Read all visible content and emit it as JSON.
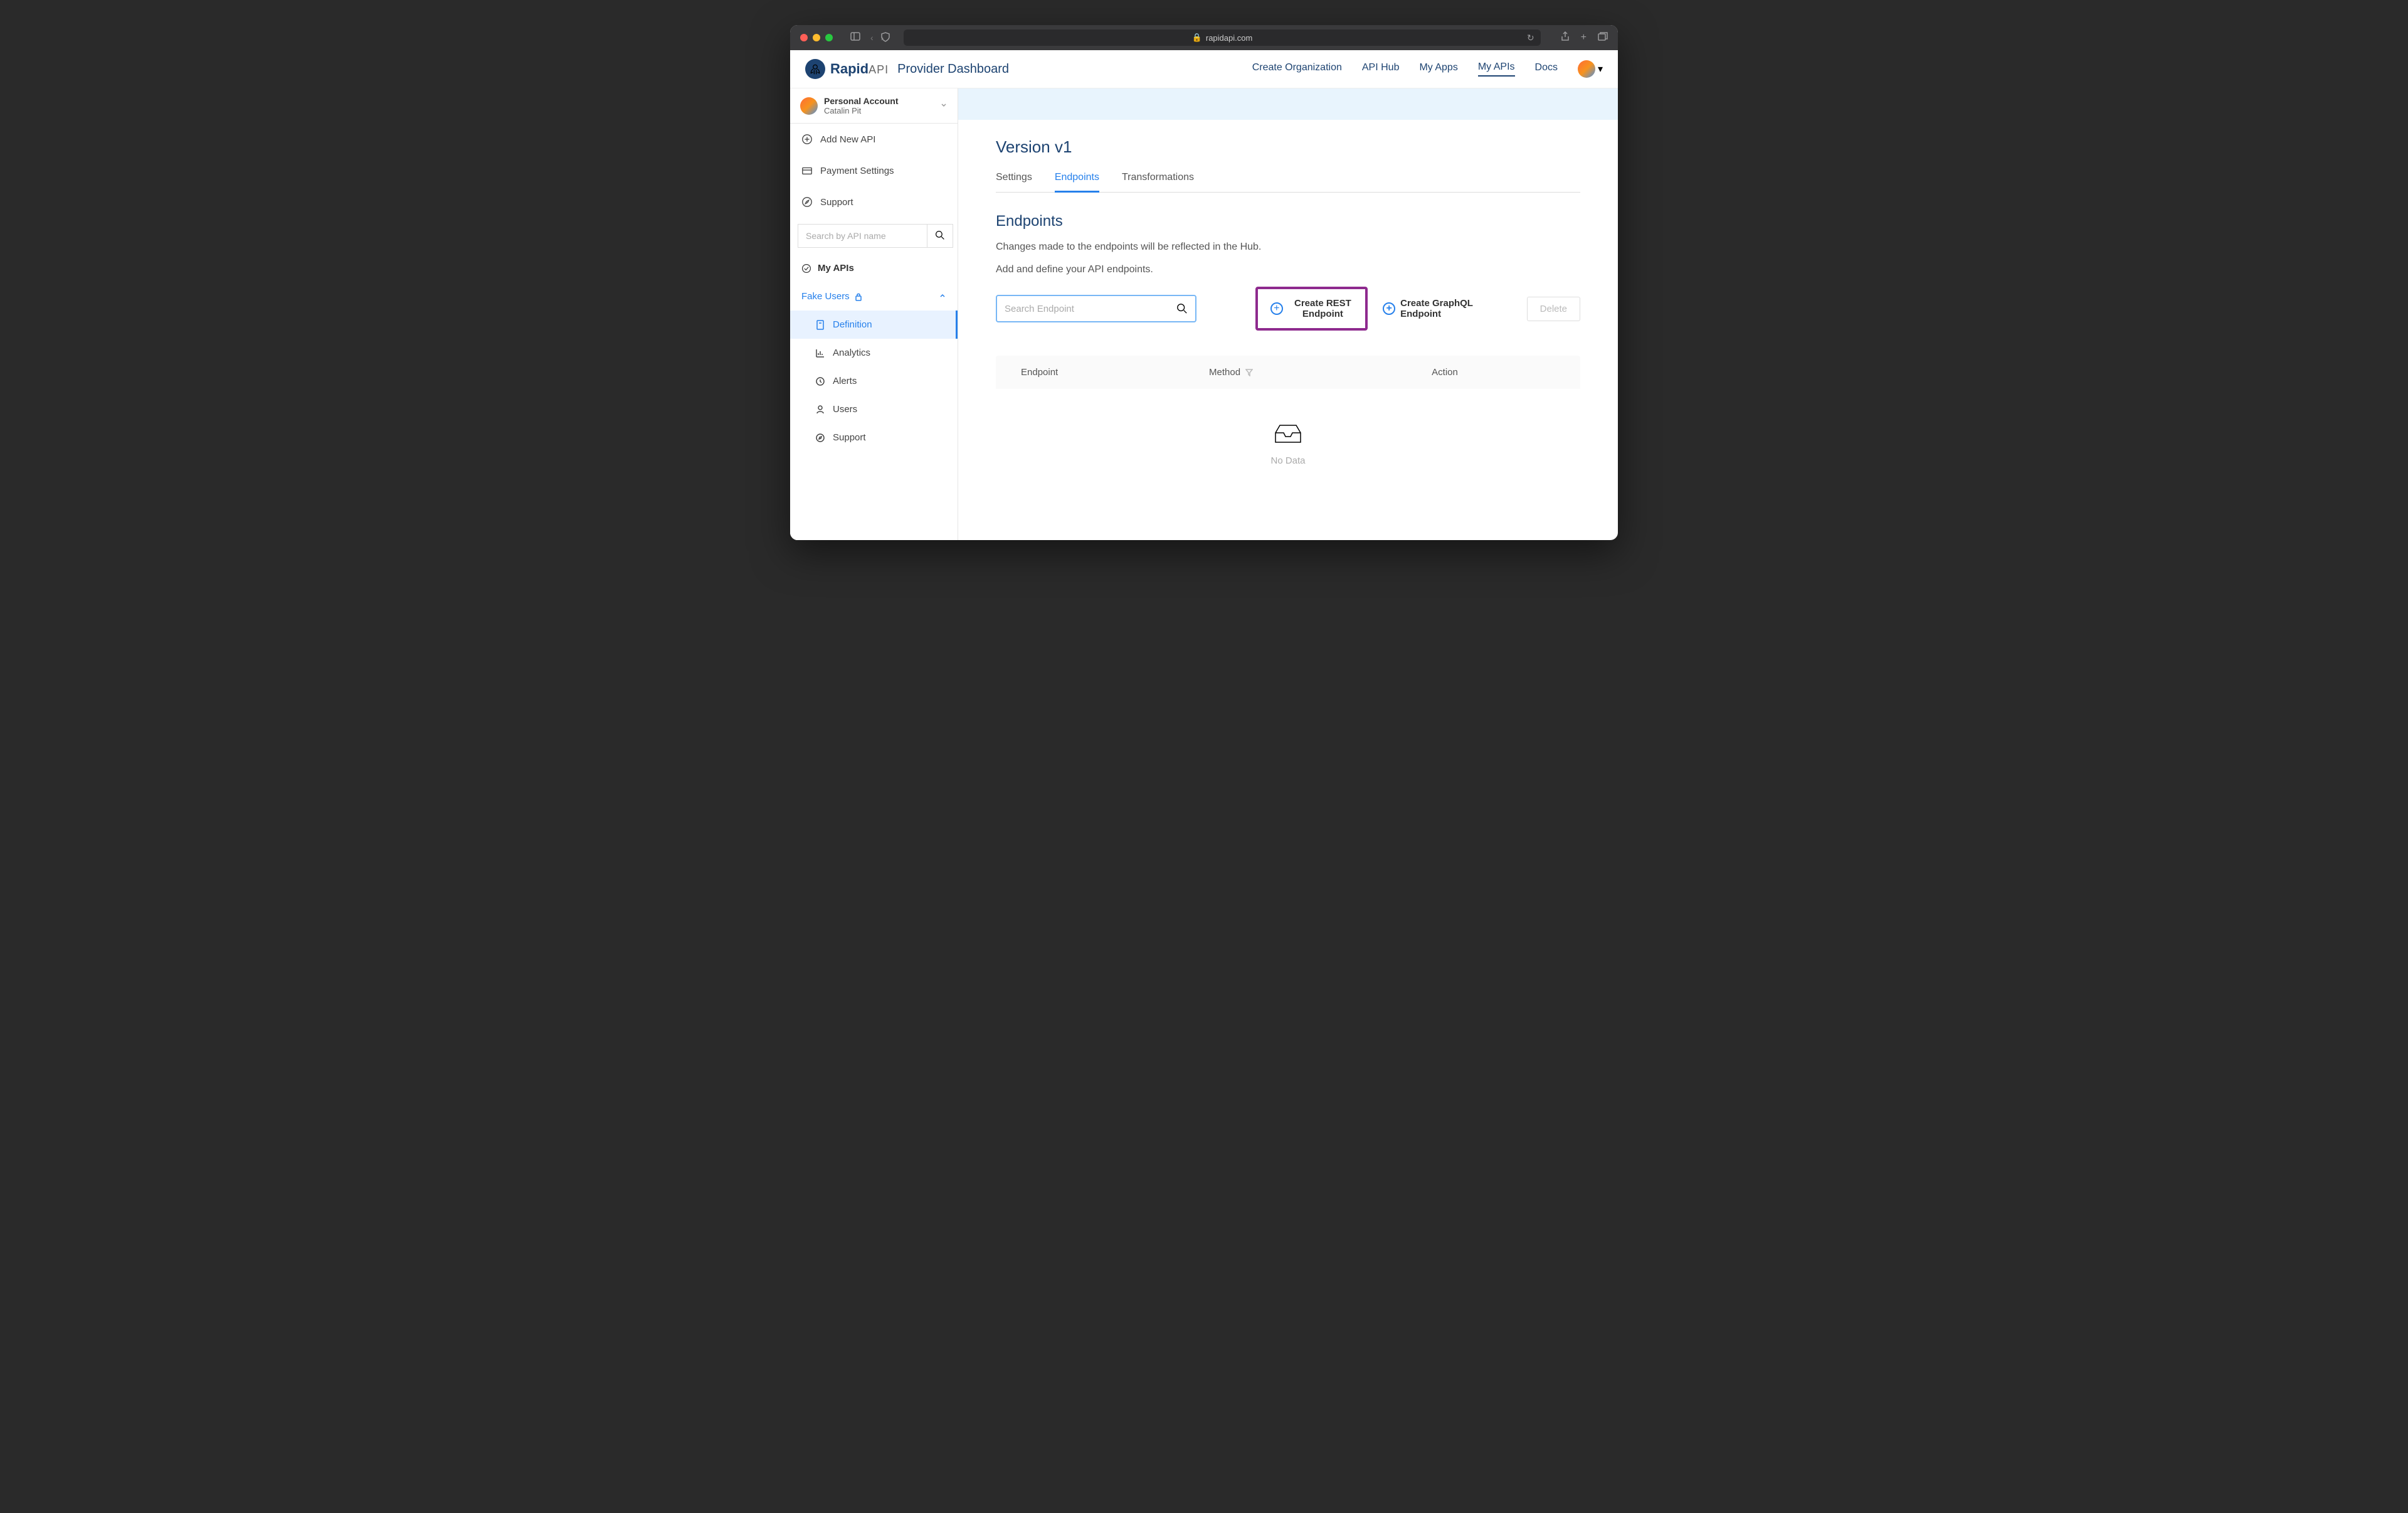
{
  "browser": {
    "url": "rapidapi.com"
  },
  "header": {
    "brand_bold": "Rapid",
    "brand_light": "API",
    "dashboard": "Provider Dashboard",
    "nav": {
      "create_org": "Create Organization",
      "api_hub": "API Hub",
      "my_apps": "My Apps",
      "my_apis": "My APIs",
      "docs": "Docs"
    }
  },
  "sidebar": {
    "account_title": "Personal Account",
    "account_name": "Catalin Pit",
    "add_api": "Add New API",
    "payment": "Payment Settings",
    "support": "Support",
    "search_placeholder": "Search by API name",
    "my_apis": "My APIs",
    "api_name": "Fake Users",
    "sub": {
      "definition": "Definition",
      "analytics": "Analytics",
      "alerts": "Alerts",
      "users": "Users",
      "support": "Support"
    }
  },
  "main": {
    "version_title": "Version v1",
    "tabs": {
      "settings": "Settings",
      "endpoints": "Endpoints",
      "transformations": "Transformations"
    },
    "section_title": "Endpoints",
    "desc1": "Changes made to the endpoints will be reflected in the Hub.",
    "desc2": "Add and define your API endpoints.",
    "search_placeholder": "Search Endpoint",
    "create_rest": "Create REST Endpoint",
    "create_gql": "Create GraphQL Endpoint",
    "delete": "Delete",
    "table": {
      "endpoint": "Endpoint",
      "method": "Method",
      "action": "Action"
    },
    "empty": "No Data"
  }
}
